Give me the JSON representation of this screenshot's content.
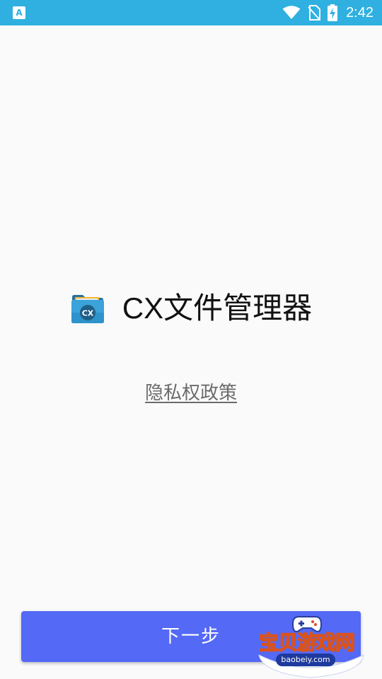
{
  "status_bar": {
    "notification_glyph": "A",
    "time": "2:42",
    "icons": [
      "notification-icon",
      "wifi-icon",
      "no-sim-icon",
      "battery-charging-icon"
    ],
    "background_color": "#2fb0e0"
  },
  "app": {
    "title": "CX文件管理器",
    "logo_icon": "cx-folder-logo-icon",
    "logo_text": "CX"
  },
  "privacy": {
    "link_text": "隐私权政策"
  },
  "actions": {
    "next_label": "下一步",
    "button_color": "#5469f5"
  },
  "watermark": {
    "text": "宝贝游戏网",
    "url": "baobeiy.com"
  }
}
